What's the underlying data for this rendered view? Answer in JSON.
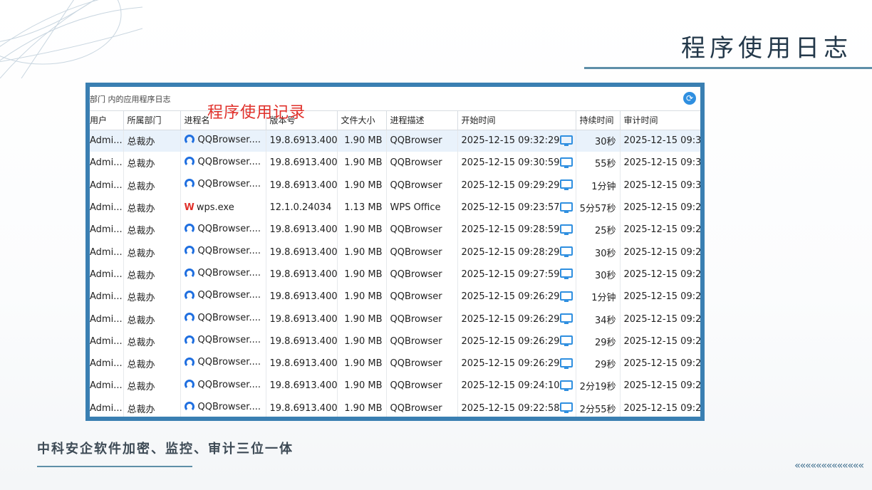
{
  "slide": {
    "title": "程序使用日志",
    "subtitle": "中科安企软件加密、监控、审计三位一体",
    "decor_chevrons": "«««««««««««««"
  },
  "panel": {
    "path_text": "部门 内的应用程序日志",
    "overlay_label": "程序使用记录",
    "refresh_icon": "refresh-icon",
    "columns": [
      "用户",
      "所属部门",
      "进程名",
      "版本号",
      "文件大小",
      "进程描述",
      "开始时间",
      "持续时间",
      "审计时间"
    ],
    "rows": [
      {
        "user": "Admi...",
        "dept": "总裁办",
        "icon": "qqbrowser-icon",
        "proc": "QQBrowser....",
        "ver": "19.8.6913.400",
        "size": "1.90 MB",
        "desc": "QQBrowser",
        "start": "2025-12-15 09:32:29",
        "dur": "30秒",
        "audit": "2025-12-15 09:3"
      },
      {
        "user": "Admi...",
        "dept": "总裁办",
        "icon": "qqbrowser-icon",
        "proc": "QQBrowser....",
        "ver": "19.8.6913.400",
        "size": "1.90 MB",
        "desc": "QQBrowser",
        "start": "2025-12-15 09:30:59",
        "dur": "55秒",
        "audit": "2025-12-15 09:3"
      },
      {
        "user": "Admi...",
        "dept": "总裁办",
        "icon": "qqbrowser-icon",
        "proc": "QQBrowser....",
        "ver": "19.8.6913.400",
        "size": "1.90 MB",
        "desc": "QQBrowser",
        "start": "2025-12-15 09:29:29",
        "dur": "1分钟",
        "audit": "2025-12-15 09:3"
      },
      {
        "user": "Admi...",
        "dept": "总裁办",
        "icon": "wps-icon",
        "proc": "wps.exe",
        "ver": "12.1.0.24034",
        "size": "1.13 MB",
        "desc": "WPS Office",
        "start": "2025-12-15 09:23:57",
        "dur": "5分57秒",
        "audit": "2025-12-15 09:2"
      },
      {
        "user": "Admi...",
        "dept": "总裁办",
        "icon": "qqbrowser-icon",
        "proc": "QQBrowser....",
        "ver": "19.8.6913.400",
        "size": "1.90 MB",
        "desc": "QQBrowser",
        "start": "2025-12-15 09:28:59",
        "dur": "25秒",
        "audit": "2025-12-15 09:2"
      },
      {
        "user": "Admi...",
        "dept": "总裁办",
        "icon": "qqbrowser-icon",
        "proc": "QQBrowser....",
        "ver": "19.8.6913.400",
        "size": "1.90 MB",
        "desc": "QQBrowser",
        "start": "2025-12-15 09:28:29",
        "dur": "30秒",
        "audit": "2025-12-15 09:2"
      },
      {
        "user": "Admi...",
        "dept": "总裁办",
        "icon": "qqbrowser-icon",
        "proc": "QQBrowser....",
        "ver": "19.8.6913.400",
        "size": "1.90 MB",
        "desc": "QQBrowser",
        "start": "2025-12-15 09:27:59",
        "dur": "30秒",
        "audit": "2025-12-15 09:2"
      },
      {
        "user": "Admi...",
        "dept": "总裁办",
        "icon": "qqbrowser-icon",
        "proc": "QQBrowser....",
        "ver": "19.8.6913.400",
        "size": "1.90 MB",
        "desc": "QQBrowser",
        "start": "2025-12-15 09:26:29",
        "dur": "1分钟",
        "audit": "2025-12-15 09:2"
      },
      {
        "user": "Admi...",
        "dept": "总裁办",
        "icon": "qqbrowser-icon",
        "proc": "QQBrowser....",
        "ver": "19.8.6913.400",
        "size": "1.90 MB",
        "desc": "QQBrowser",
        "start": "2025-12-15 09:26:29",
        "dur": "34秒",
        "audit": "2025-12-15 09:2"
      },
      {
        "user": "Admi...",
        "dept": "总裁办",
        "icon": "qqbrowser-icon",
        "proc": "QQBrowser....",
        "ver": "19.8.6913.400",
        "size": "1.90 MB",
        "desc": "QQBrowser",
        "start": "2025-12-15 09:26:29",
        "dur": "29秒",
        "audit": "2025-12-15 09:2"
      },
      {
        "user": "Admi...",
        "dept": "总裁办",
        "icon": "qqbrowser-icon",
        "proc": "QQBrowser....",
        "ver": "19.8.6913.400",
        "size": "1.90 MB",
        "desc": "QQBrowser",
        "start": "2025-12-15 09:26:29",
        "dur": "29秒",
        "audit": "2025-12-15 09:2"
      },
      {
        "user": "Admi...",
        "dept": "总裁办",
        "icon": "qqbrowser-icon",
        "proc": "QQBrowser....",
        "ver": "19.8.6913.400",
        "size": "1.90 MB",
        "desc": "QQBrowser",
        "start": "2025-12-15 09:24:10",
        "dur": "2分19秒",
        "audit": "2025-12-15 09:2"
      },
      {
        "user": "Admi...",
        "dept": "总裁办",
        "icon": "qqbrowser-icon",
        "proc": "QQBrowser....",
        "ver": "19.8.6913.400",
        "size": "1.90 MB",
        "desc": "QQBrowser",
        "start": "2025-12-15 09:22:58",
        "dur": "2分55秒",
        "audit": "2025-12-15 09:2"
      }
    ]
  },
  "colors": {
    "frame_border": "#3a7fb2",
    "title_text": "#23384a",
    "accent_line": "#5e8fa8",
    "overlay_red": "#e0302a",
    "monitor_blue": "#2f8fe0",
    "selected_row": "#e9f2fb"
  }
}
